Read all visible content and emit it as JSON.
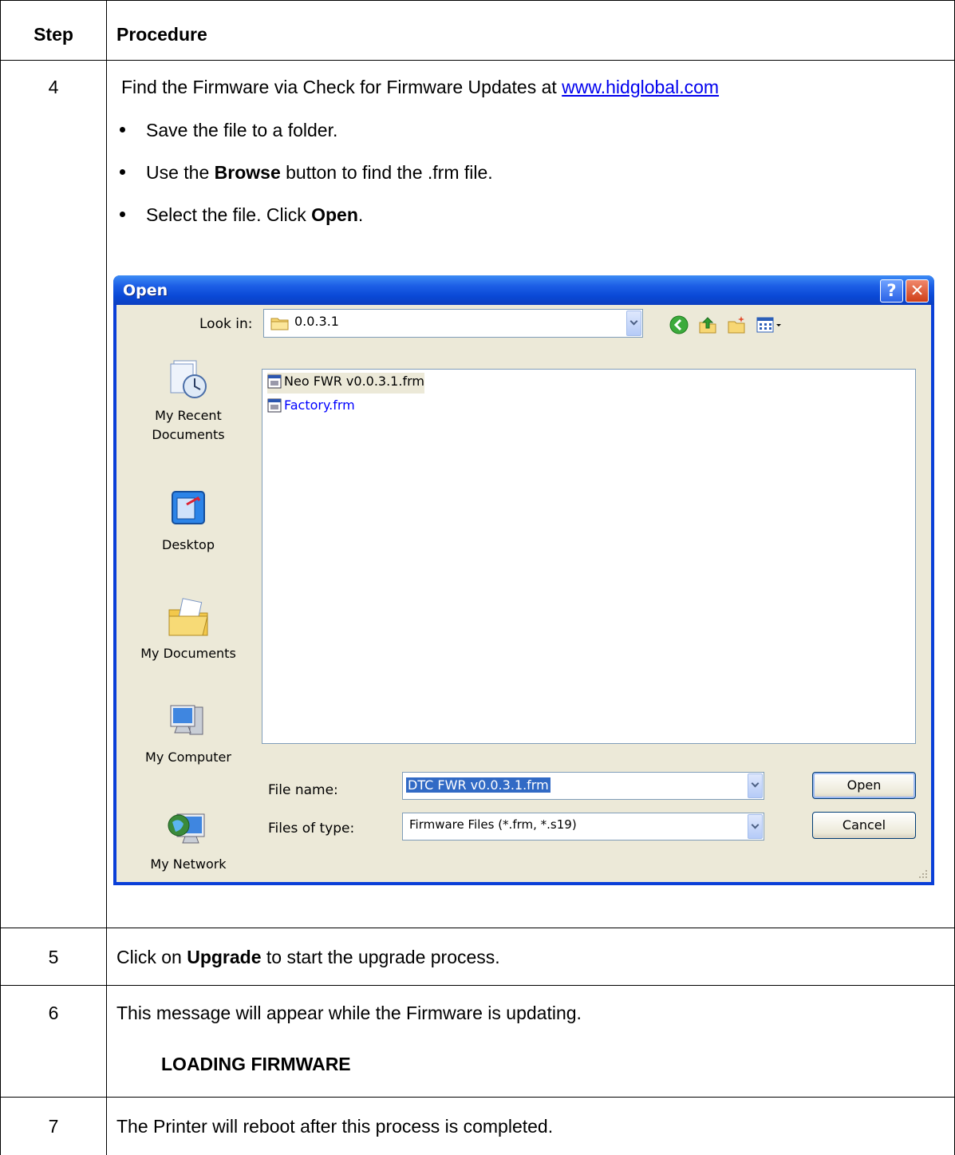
{
  "table": {
    "header": {
      "step": "Step",
      "procedure": "Procedure"
    },
    "row4": {
      "step": "4",
      "intro_pre": "Find the Firmware via Check for Firmware Updates at ",
      "intro_link": "www.hidglobal.com",
      "bullets": [
        {
          "pre": "Save the file to a folder.",
          "bold": "",
          "post": ""
        },
        {
          "pre": "Use the ",
          "bold": "Browse",
          "post": " button to find the .frm file."
        },
        {
          "pre": "Select the file. Click ",
          "bold": "Open",
          "post": "."
        }
      ]
    },
    "row5": {
      "step": "5",
      "pre": "Click on ",
      "bold": "Upgrade",
      "post": " to start the upgrade process."
    },
    "row6": {
      "step": "6",
      "text": "This message will appear while the Firmware is updating.",
      "message": "LOADING FIRMWARE"
    },
    "row7": {
      "step": "7",
      "text": "The Printer will reboot after this process is completed."
    }
  },
  "dialog": {
    "title": "Open",
    "help_label": "?",
    "close_label": "✕",
    "look_in_label": "Look in:",
    "look_in_value": "0.0.3.1",
    "toolbar_icons": [
      "back-icon",
      "up-folder-icon",
      "new-folder-icon",
      "views-menu-icon"
    ],
    "places": [
      {
        "label_1": "My Recent",
        "label_2": "Documents",
        "icon": "recent-documents-icon"
      },
      {
        "label_1": "Desktop",
        "label_2": "",
        "icon": "desktop-icon"
      },
      {
        "label_1": "My Documents",
        "label_2": "",
        "icon": "my-documents-icon"
      },
      {
        "label_1": "My Computer",
        "label_2": "",
        "icon": "my-computer-icon"
      },
      {
        "label_1": "My Network",
        "label_2": "",
        "icon": "my-network-icon"
      }
    ],
    "files": [
      {
        "name": "Neo FWR v0.0.3.1.frm",
        "color": "#000000"
      },
      {
        "name": "Factory.frm",
        "color": "#0000ff"
      }
    ],
    "file_name_label": "File name:",
    "file_name_value": "DTC FWR v0.0.3.1.frm",
    "files_of_type_label": "Files of type:",
    "files_of_type_value": "Firmware Files (*.frm, *.s19)",
    "open_button": "Open",
    "cancel_button": "Cancel",
    "colors": {
      "titlebar": "#0a49d6",
      "body": "#ece9d8",
      "selection": "#316ac5"
    }
  }
}
